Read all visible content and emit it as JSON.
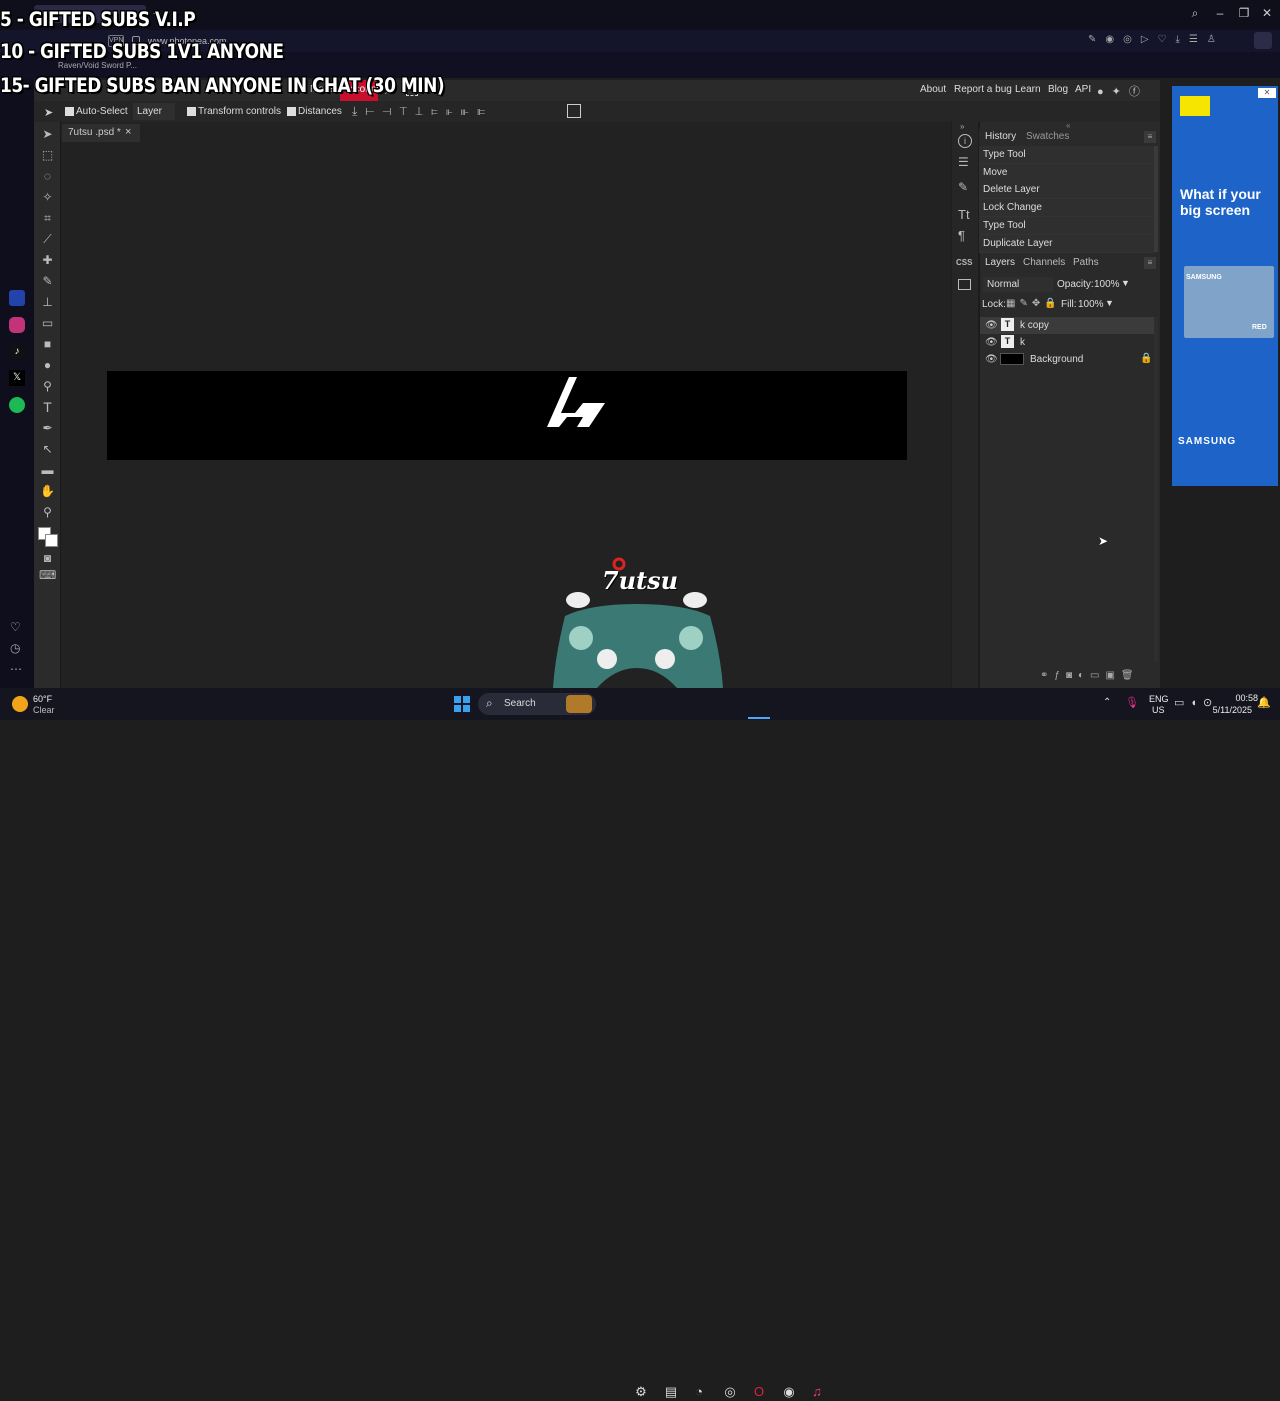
{
  "overlay": {
    "line1": "5 - GIFTED SUBS V.I.P",
    "line2": "10 - GIFTED SUBS 1V1 ANYONE",
    "line3": "15- GIFTED SUBS BAN ANYONE IN CHAT (30 MIN)"
  },
  "browser": {
    "url": "www.photopea.com",
    "bookmark": "Raven/Void Sword P...",
    "vpn_label": "VPN"
  },
  "menubar": {
    "more": "More",
    "account": "Account",
    "about": "About",
    "report_bug": "Report a bug",
    "learn": "Learn",
    "blog": "Blog",
    "api": "API"
  },
  "options": {
    "auto_select": "Auto-Select",
    "layer_select": "Layer",
    "transform_controls": "Transform controls",
    "distances": "Distances"
  },
  "document": {
    "tab_name": "7utsu .psd *",
    "close": "×"
  },
  "history": {
    "tab_history": "History",
    "tab_swatches": "Swatches",
    "items": [
      "Type Tool",
      "Move",
      "Delete Layer",
      "Lock Change",
      "Type Tool",
      "Duplicate Layer"
    ]
  },
  "layers": {
    "tab_layers": "Layers",
    "tab_channels": "Channels",
    "tab_paths": "Paths",
    "blend_mode": "Normal",
    "opacity_label": "Opacity:",
    "opacity_value": "100%",
    "lock_label": "Lock:",
    "fill_label": "Fill:",
    "fill_value": "100%",
    "items": [
      {
        "name": "k copy",
        "type": "T"
      },
      {
        "name": "k",
        "type": "T"
      },
      {
        "name": "Background",
        "type": "bg"
      }
    ]
  },
  "ad": {
    "headline": "What if your big screen",
    "brand": "SAMSUNG",
    "tv_brand": "SAMSUNG",
    "tv_tag": "RED"
  },
  "webcam": {
    "logo_text": "7utsu"
  },
  "taskbar": {
    "weather_temp": "60°F",
    "weather_desc": "Clear",
    "search": "Search",
    "lang_top": "ENG",
    "lang_bottom": "US",
    "time": "00:58",
    "date": "5/11/2025"
  },
  "colors": {
    "accent_account": "#c8102e",
    "ad_blue": "#1e64c8",
    "canvas_bg": "#222222"
  }
}
